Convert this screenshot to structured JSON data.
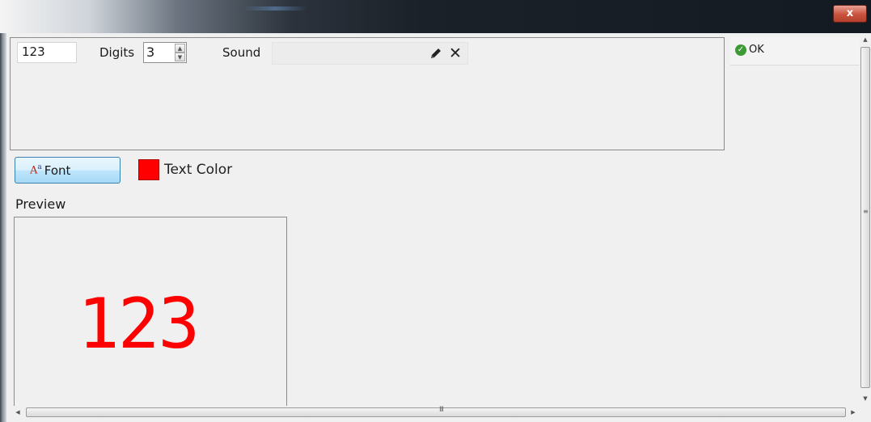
{
  "window": {
    "close_label": "x"
  },
  "top_panel": {
    "number_value": "123",
    "digits_label": "Digits",
    "digits_value": "3",
    "sound_label": "Sound",
    "sound_value": "",
    "pencil_icon": "pencil-icon",
    "clear_icon_glyph": "✕"
  },
  "ok_button": {
    "label": "OK",
    "icon": "check-circle-icon",
    "icon_glyph": "✓"
  },
  "style_row": {
    "font_button_label": "Font",
    "font_icon_main": "A",
    "font_icon_sup": "a",
    "text_color_label": "Text Color",
    "text_color": "#ff0000"
  },
  "preview": {
    "label": "Preview",
    "text": "123"
  },
  "scrollbars": {
    "h_grip": "III",
    "v_grip": "≡",
    "up_arrow": "▲",
    "down_arrow": "▼",
    "left_arrow": "◀",
    "right_arrow": "▶"
  }
}
